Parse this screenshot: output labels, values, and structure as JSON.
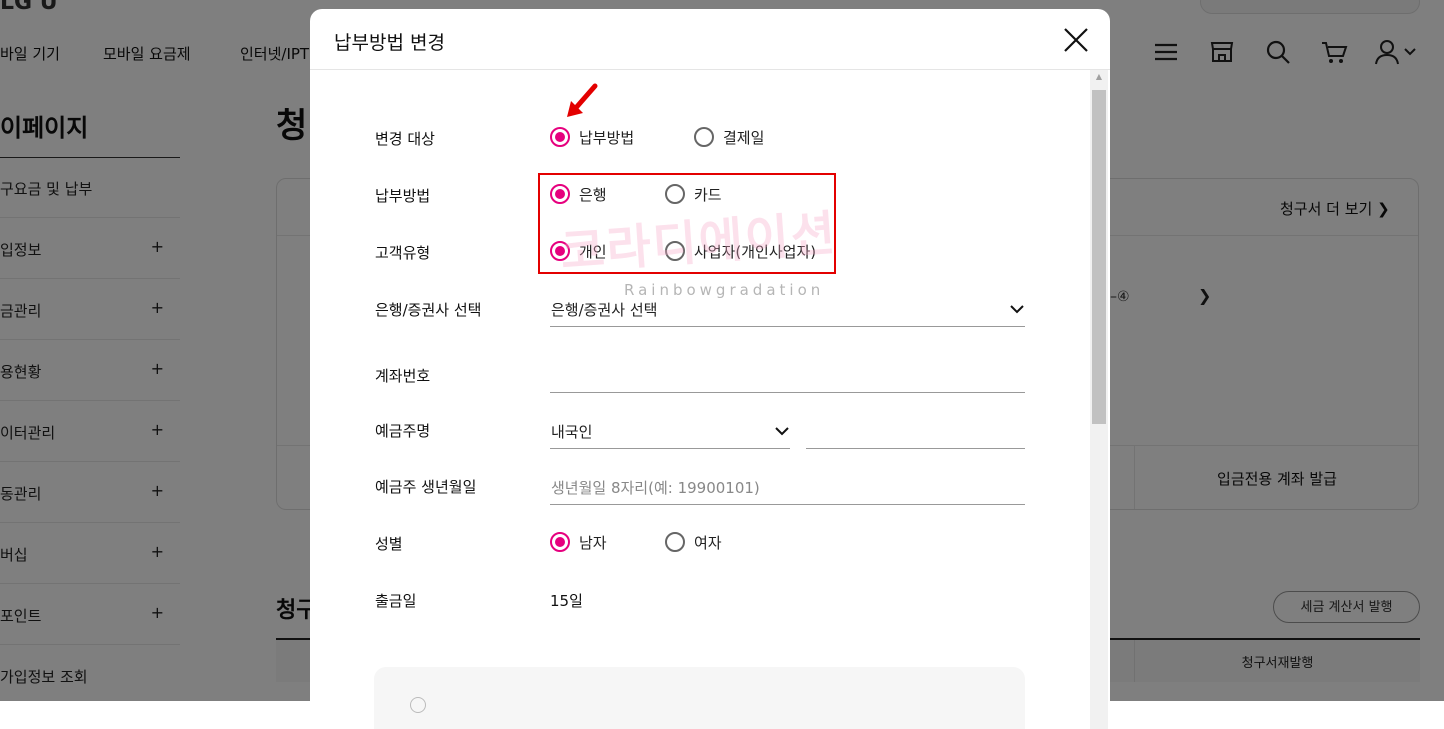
{
  "background": {
    "logo": "LG U",
    "gnb": [
      "바일 기기",
      "모바일 요금제",
      "인터넷/IPT"
    ],
    "header_icons": [
      "menu-icon",
      "store-icon",
      "search-icon",
      "cart-icon",
      "user-icon"
    ],
    "sidebar": {
      "title": "이페이지",
      "items": [
        {
          "label": "구요금 및 납부",
          "plus": ""
        },
        {
          "label": "입정보",
          "plus": "+"
        },
        {
          "label": "금관리",
          "plus": "+"
        },
        {
          "label": "용현황",
          "plus": "+"
        },
        {
          "label": "이터관리",
          "plus": "+"
        },
        {
          "label": "동관리",
          "plus": "+"
        },
        {
          "label": "버십",
          "plus": "+"
        },
        {
          "label": "포인트",
          "plus": "+"
        },
        {
          "label": "가입정보 조회",
          "plus": ""
        }
      ]
    },
    "main_title": "청",
    "bill_more": "청구서 더 보기",
    "card_fragment": "–④",
    "deposit_account": "입금전용 계좌 발급",
    "section_title": "청구",
    "tax_invoice_button": "세금 계산서 발행",
    "table_header": "청구서재발행"
  },
  "modal": {
    "title": "납부방법 변경",
    "rows": {
      "change_target": {
        "label": "변경 대상",
        "options": [
          {
            "label": "납부방법",
            "selected": true
          },
          {
            "label": "결제일",
            "selected": false
          }
        ]
      },
      "payment_method": {
        "label": "납부방법",
        "options": [
          {
            "label": "은행",
            "selected": true
          },
          {
            "label": "카드",
            "selected": false
          }
        ]
      },
      "customer_type": {
        "label": "고객유형",
        "options": [
          {
            "label": "개인",
            "selected": true
          },
          {
            "label": "사업자(개인사업자)",
            "selected": false
          }
        ]
      },
      "bank_select": {
        "label": "은행/증권사 선택",
        "value": "은행/증권사 선택"
      },
      "account_number": {
        "label": "계좌번호",
        "value": ""
      },
      "depositor": {
        "label": "예금주명",
        "nationality": "내국인",
        "name": ""
      },
      "birth": {
        "label": "예금주 생년월일",
        "placeholder": "생년월일 8자리(예: 19900101)"
      },
      "gender": {
        "label": "성별",
        "options": [
          {
            "label": "남자",
            "selected": true
          },
          {
            "label": "여자",
            "selected": false
          }
        ]
      },
      "withdraw_day": {
        "label": "출금일",
        "value": "15일"
      }
    }
  },
  "watermark": {
    "text": "코라디에이션",
    "subtitle": "Rainbowgradation"
  },
  "colors": {
    "accent": "#e6007e",
    "highlight_box": "#e30000",
    "overlay": "rgba(0,0,0,0.5)"
  }
}
